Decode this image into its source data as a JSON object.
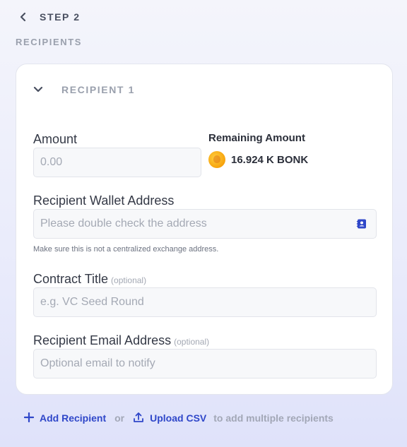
{
  "header": {
    "step_label": "STEP 2",
    "section_label": "RECIPIENTS"
  },
  "recipient": {
    "title": "RECIPIENT 1",
    "amount": {
      "label": "Amount",
      "placeholder": "0.00"
    },
    "remaining": {
      "label": "Remaining Amount",
      "value": "16.924 K BONK",
      "token_icon": "bonk-token-icon"
    },
    "wallet": {
      "label": "Recipient Wallet Address",
      "placeholder": "Please double check the address",
      "hint": "Make sure this is not a centralized exchange address.",
      "icon": "address-book-icon"
    },
    "contract_title": {
      "label": "Contract Title",
      "optional": "(optional)",
      "placeholder": "e.g. VC Seed Round"
    },
    "email": {
      "label": "Recipient Email Address",
      "optional": "(optional)",
      "placeholder": "Optional email to notify"
    }
  },
  "footer": {
    "add_recipient": "Add Recipient",
    "or": "or",
    "upload_csv": "Upload CSV",
    "suffix": "to add multiple recipients"
  },
  "colors": {
    "accent": "#2f47c9",
    "background": "#eef0fb"
  }
}
